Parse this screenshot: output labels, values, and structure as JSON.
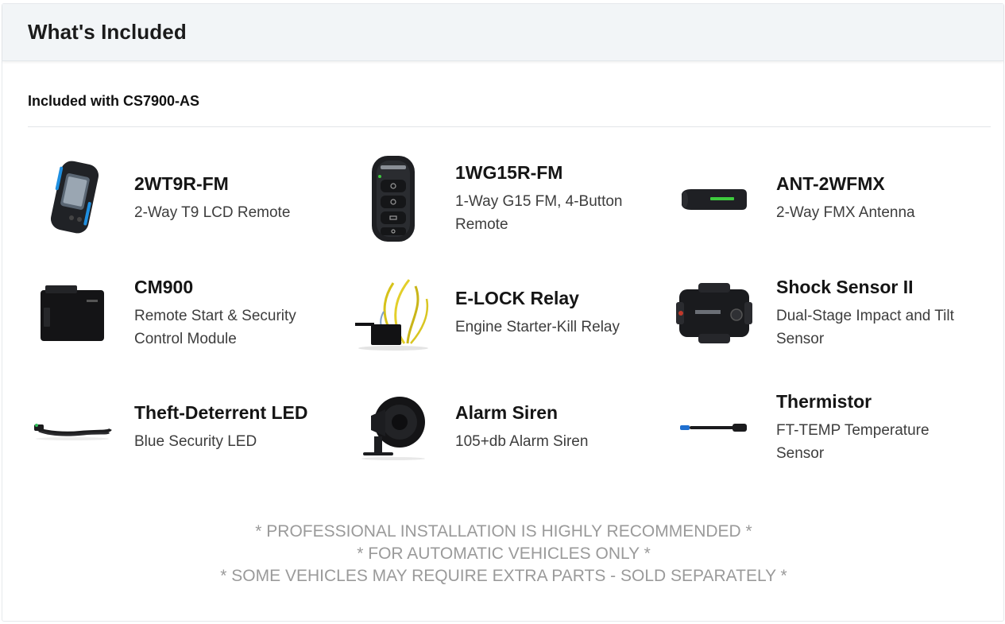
{
  "header": {
    "title": "What's Included"
  },
  "section": {
    "subtitle": "Included with CS7900-AS"
  },
  "items": [
    {
      "name": "2WT9R-FM",
      "desc": "2-Way T9 LCD Remote",
      "icon": "lcd-remote-icon"
    },
    {
      "name": "1WG15R-FM",
      "desc": "1-Way G15 FM, 4-Button Remote",
      "icon": "four-button-remote-icon"
    },
    {
      "name": "ANT-2WFMX",
      "desc": "2-Way FMX Antenna",
      "icon": "antenna-icon"
    },
    {
      "name": "CM900",
      "desc": "Remote Start & Security Control Module",
      "icon": "control-module-icon"
    },
    {
      "name": "E-LOCK Relay",
      "desc": "Engine Starter-Kill Relay",
      "icon": "relay-icon"
    },
    {
      "name": "Shock Sensor II",
      "desc": "Dual-Stage Impact and Tilt Sensor",
      "icon": "shock-sensor-icon"
    },
    {
      "name": "Theft-Deterrent LED",
      "desc": "Blue Security LED",
      "icon": "led-icon"
    },
    {
      "name": "Alarm Siren",
      "desc": "105+db Alarm Siren",
      "icon": "siren-icon"
    },
    {
      "name": "Thermistor",
      "desc": "FT-TEMP Temperature Sensor",
      "icon": "thermistor-icon"
    }
  ],
  "notes": [
    "* PROFESSIONAL INSTALLATION IS HIGHLY RECOMMENDED *",
    "* FOR AUTOMATIC VEHICLES ONLY *",
    "* SOME VEHICLES MAY REQUIRE EXTRA PARTS - SOLD SEPARATELY *"
  ],
  "colors": {
    "header_bg": "#f2f5f7",
    "notes_text": "#9a9a9a",
    "accent_blue": "#1f8fe0",
    "accent_green": "#3ecb3e"
  }
}
